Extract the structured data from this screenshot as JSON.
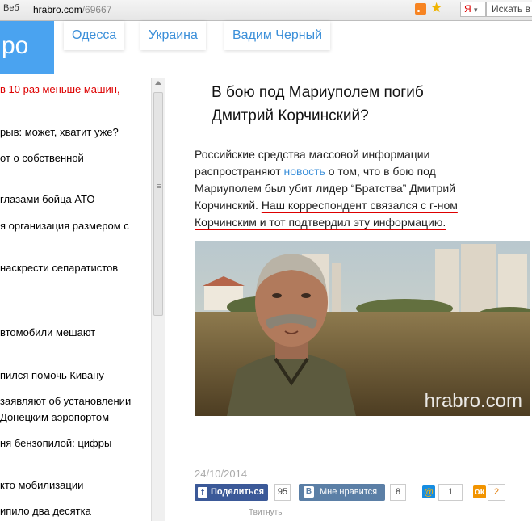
{
  "browser": {
    "tab_label": "Веб",
    "url_host": "hrabro.com",
    "url_path": "/69667",
    "yandex_label": "Я",
    "search_placeholder": "Искать в"
  },
  "site": {
    "logo_text": "ро",
    "nav": [
      "Одесса",
      "Украина",
      "Вадим Черный"
    ]
  },
  "sidebar": {
    "items": [
      "в 10 раз меньше машин,",
      "рыв: может, хватит уже?",
      "от о собственной",
      "глазами бойца АТО",
      "я организация размером с",
      " наскрести сепаратистов",
      "втомобили мешают",
      "пился помочь Кивану",
      "заявляют об установлении",
      " Донецким аэропортом",
      "ня бензопилой: цифры",
      "кто мобилизации",
      "ипило два десятка"
    ]
  },
  "article": {
    "title": "В бою под Мариуполем погиб Дмитрий Корчинский?",
    "para_start": "Российские средства массовой информации распространяют ",
    "para_link": "новость",
    "para_mid": " о том, что в бою под Мариуполем был убит лидер “Братства” Дмитрий Корчинский. ",
    "para_underlined": "Наш корреспондент связался с г-ном Корчинским и тот подтвердил эту информацию.",
    "image_watermark": "hrabro.com",
    "date": "24/10/2014"
  },
  "social": {
    "fb_icon": "f",
    "fb_label": "Поделиться",
    "fb_count": "95",
    "vk_icon": "В",
    "vk_label": "Мне нравится",
    "vk_count": "8",
    "mail_icon": "@",
    "mail_count": "1",
    "ok_icon": "ок",
    "ok_count": "2",
    "tweet_label": "Твитнуть"
  },
  "colors": {
    "accent": "#4aa3f0",
    "link": "#3b8fd9",
    "highlight_underline": "#dd0000",
    "facebook": "#3b5998",
    "vkontakte": "#5b7fa6"
  }
}
